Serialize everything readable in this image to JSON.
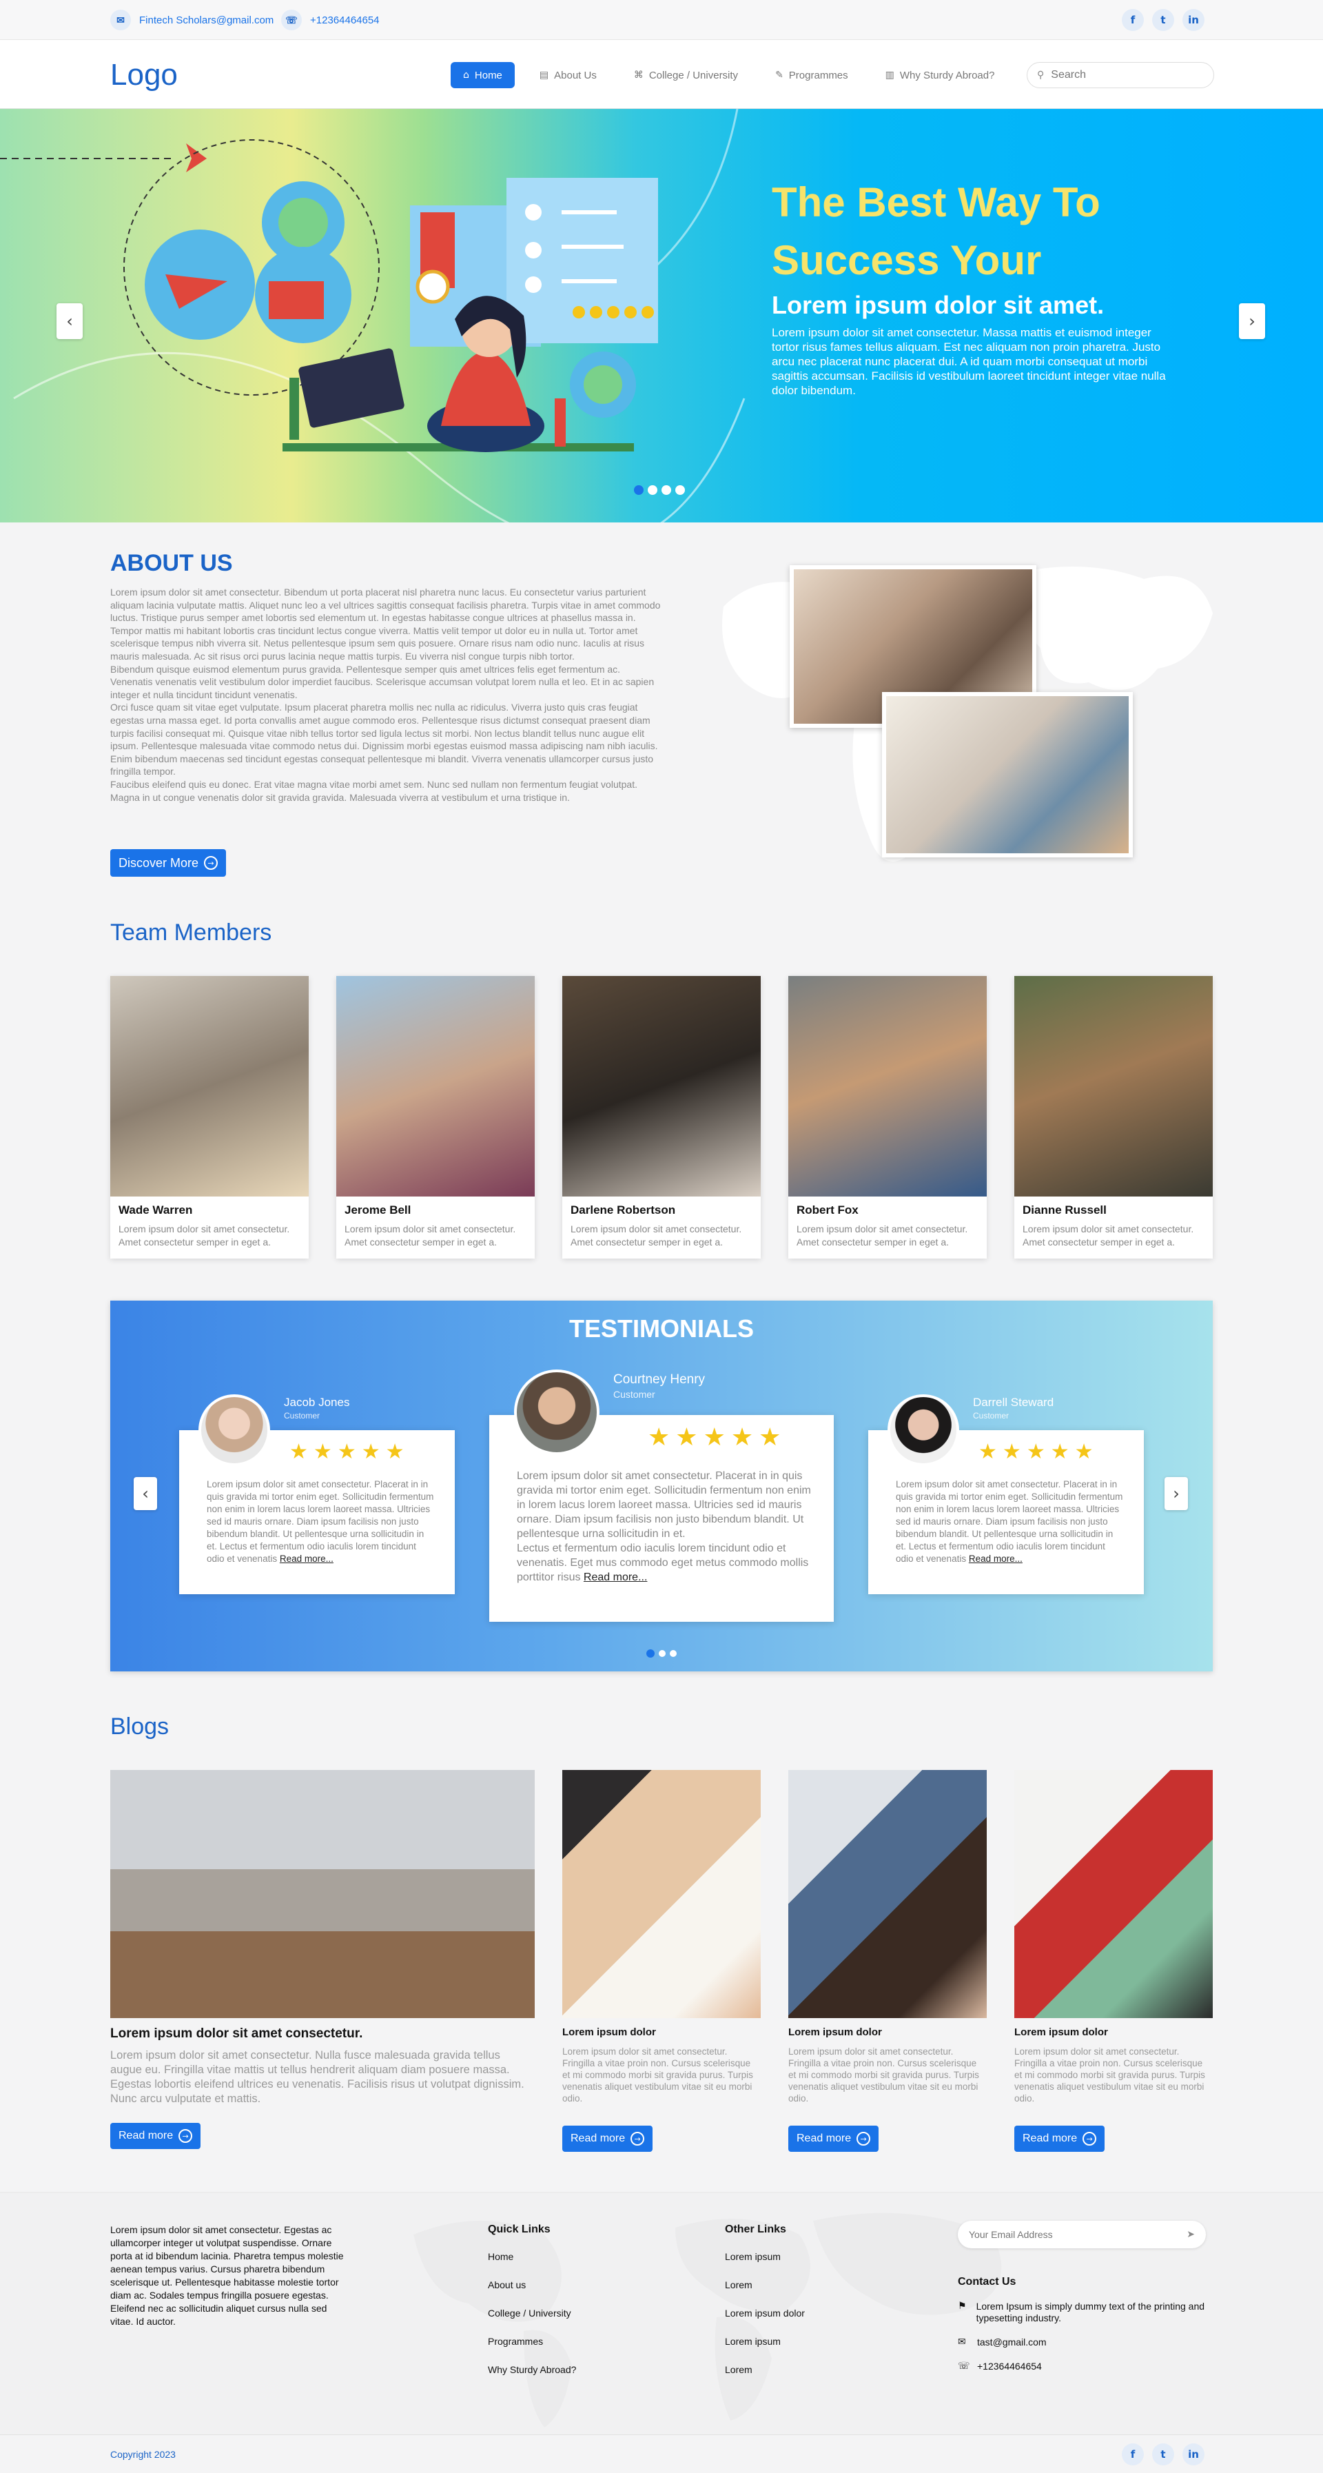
{
  "topbar": {
    "email": "Fintech Scholars@gmail.com",
    "phone": "+12364464654",
    "email_icon": "mail-icon",
    "phone_icon": "phone-icon",
    "social": [
      "facebook-icon",
      "twitter-icon",
      "linkedin-icon"
    ]
  },
  "header": {
    "logo": "Logo",
    "nav": [
      {
        "label": "Home",
        "icon": "home-icon",
        "active": true
      },
      {
        "label": "About Us",
        "icon": "document-icon"
      },
      {
        "label": "College / University",
        "icon": "building-icon"
      },
      {
        "label": "Programmes",
        "icon": "pen-icon"
      },
      {
        "label": "Why Sturdy Abroad?",
        "icon": "page-icon"
      }
    ],
    "search_placeholder": "Search"
  },
  "hero": {
    "title": "The Best Way To Success Your",
    "subtitle": "Lorem ipsum dolor sit amet.",
    "text": "Lorem ipsum dolor sit amet consectetur. Massa mattis et euismod integer tortor risus fames tellus aliquam. Est nec aliquam non proin pharetra. Justo arcu nec placerat nunc placerat dui. A id quam morbi consequat ut morbi sagittis accumsan. Facilisis id vestibulum laoreet tincidunt integer vitae nulla dolor bibendum.",
    "slides": 4,
    "active_slide": 1
  },
  "about": {
    "title": "ABOUT US",
    "text": "Lorem ipsum dolor sit amet consectetur. Bibendum ut porta placerat nisl pharetra nunc lacus. Eu consectetur varius parturient aliquam lacinia vulputate mattis. Aliquet nunc leo a vel ultrices sagittis consequat facilisis pharetra. Turpis vitae in amet commodo luctus. Tristique purus semper amet lobortis sed elementum ut. In egestas habitasse congue ultrices at phasellus massa in. Tempor mattis mi habitant lobortis cras tincidunt lectus congue viverra. Mattis velit tempor ut dolor eu in nulla ut. Tortor amet scelerisque tempus nibh viverra sit. Netus pellentesque ipsum sem quis posuere. Ornare risus nam odio nunc. Iaculis at risus mauris malesuada. Ac sit risus orci purus lacinia neque mattis turpis. Eu viverra nisl congue turpis nibh tortor.\nBibendum quisque euismod elementum purus gravida. Pellentesque semper quis amet ultrices felis eget fermentum ac. Venenatis venenatis velit vestibulum dolor imperdiet faucibus. Scelerisque accumsan volutpat lorem nulla et leo. Et in ac sapien integer et nulla tincidunt tincidunt venenatis.\nOrci fusce quam sit vitae eget vulputate. Ipsum placerat pharetra mollis nec nulla ac ridiculus. Viverra justo quis cras feugiat egestas urna massa eget. Id porta convallis amet augue commodo eros. Pellentesque risus dictumst consequat praesent diam turpis facilisi consequat mi. Quisque vitae nibh tellus tortor sed ligula lectus sit morbi. Non lectus blandit tellus nunc augue elit ipsum. Pellentesque malesuada vitae commodo netus dui. Dignissim morbi egestas euismod massa adipiscing nam nibh iaculis. Enim bibendum maecenas sed tincidunt egestas consequat pellentesque mi blandit. Viverra venenatis ullamcorper cursus justo fringilla tempor.\nFaucibus eleifend quis eu donec. Erat vitae magna vitae morbi amet sem. Nunc sed nullam non fermentum feugiat volutpat. Magna in ut congue venenatis dolor sit gravida gravida. Malesuada viverra at vestibulum et urna tristique in.",
    "button": "Discover More"
  },
  "team": {
    "title": "Team Members",
    "members": [
      {
        "name": "Wade Warren",
        "desc": "Lorem ipsum dolor sit amet consectetur. Amet consectetur semper in eget a."
      },
      {
        "name": "Jerome Bell",
        "desc": "Lorem ipsum dolor sit amet consectetur. Amet consectetur semper in eget a."
      },
      {
        "name": "Darlene Robertson",
        "desc": "Lorem ipsum dolor sit amet consectetur. Amet consectetur semper in eget a."
      },
      {
        "name": "Robert Fox",
        "desc": "Lorem ipsum dolor sit amet consectetur. Amet consectetur semper in eget a."
      },
      {
        "name": "Dianne Russell",
        "desc": "Lorem ipsum dolor sit amet consectetur. Amet consectetur semper in eget a."
      }
    ]
  },
  "testimonials": {
    "title": "TESTIMONIALS",
    "items": [
      {
        "name": "Jacob Jones",
        "role": "Customer",
        "rating": 5,
        "text": "Lorem ipsum dolor sit amet consectetur. Placerat in in quis gravida mi tortor enim eget. Sollicitudin fermentum non enim in lorem lacus lorem laoreet massa. Ultricies sed id mauris ornare. Diam ipsum facilisis non justo bibendum blandit. Ut pellentesque urna sollicitudin in et. Lectus et fermentum odio iaculis lorem tincidunt odio et venenatis",
        "more": "Read more..."
      },
      {
        "name": "Courtney Henry",
        "role": "Customer",
        "rating": 5,
        "text": "Lorem ipsum dolor sit amet consectetur. Placerat in in quis gravida mi tortor enim eget. Sollicitudin fermentum non enim in lorem lacus lorem laoreet massa. Ultricies sed id mauris ornare. Diam ipsum facilisis non justo bibendum blandit. Ut pellentesque urna sollicitudin in et.\nLectus et fermentum odio iaculis lorem tincidunt odio et venenatis. Eget mus commodo eget metus commodo mollis porttitor risus",
        "more": "Read more..."
      },
      {
        "name": "Darrell Steward",
        "role": "Customer",
        "rating": 5,
        "text": "Lorem ipsum dolor sit amet consectetur. Placerat in in quis gravida mi tortor enim eget. Sollicitudin fermentum non enim in lorem lacus lorem laoreet massa. Ultricies sed id mauris ornare. Diam ipsum facilisis non justo bibendum blandit. Ut pellentesque urna sollicitudin in et. Lectus et fermentum odio iaculis lorem tincidunt odio et venenatis",
        "more": "Read more..."
      }
    ],
    "slides": 3,
    "active_slide": 1
  },
  "blogs": {
    "title": "Blogs",
    "items": [
      {
        "title": "Lorem ipsum dolor sit amet consectetur.",
        "desc": "Lorem ipsum dolor sit amet consectetur. Nulla fusce malesuada gravida tellus augue eu. Fringilla vitae mattis ut tellus hendrerit aliquam diam posuere massa. Egestas lobortis eleifend ultrices eu venenatis. Facilisis risus ut volutpat dignissim. Nunc arcu vulputate et mattis.",
        "button": "Read more"
      },
      {
        "title": "Lorem ipsum dolor",
        "desc": "Lorem ipsum dolor sit amet consectetur. Fringilla a vitae proin non. Cursus scelerisque et mi commodo morbi sit gravida purus. Turpis venenatis aliquet vestibulum vitae sit eu morbi odio.",
        "button": "Read more"
      },
      {
        "title": "Lorem ipsum dolor",
        "desc": "Lorem ipsum dolor sit amet consectetur. Fringilla a vitae proin non. Cursus scelerisque et mi commodo morbi sit gravida purus. Turpis venenatis aliquet vestibulum vitae sit eu morbi odio.",
        "button": "Read more"
      },
      {
        "title": "Lorem ipsum dolor",
        "desc": "Lorem ipsum dolor sit amet consectetur. Fringilla a vitae proin non. Cursus scelerisque et mi commodo morbi sit gravida purus. Turpis venenatis aliquet vestibulum vitae sit eu morbi odio.",
        "button": "Read more"
      }
    ]
  },
  "footer": {
    "about": "Lorem ipsum dolor sit amet consectetur. Egestas ac ullamcorper integer ut volutpat suspendisse. Ornare porta at id bibendum lacinia. Pharetra tempus molestie aenean tempus varius. Cursus pharetra bibendum scelerisque ut. Pellentesque habitasse molestie tortor diam ac. Sodales tempus fringilla posuere egestas. Eleifend nec ac sollicitudin aliquet cursus nulla sed vitae. Id auctor.",
    "quick_links_title": "Quick Links",
    "quick_links": [
      "Home",
      "About us",
      "College / University",
      "Programmes",
      "Why Sturdy Abroad?"
    ],
    "other_links_title": "Other Links",
    "other_links": [
      "Lorem ipsum",
      "Lorem",
      "Lorem ipsum dolor",
      "Lorem ipsum",
      "Lorem"
    ],
    "email_placeholder": "Your Email Address",
    "contact_title": "Contact Us",
    "address": "Lorem Ipsum is simply dummy text of the printing and typesetting industry.",
    "email": "tast@gmail.com",
    "phone": "+12364464654",
    "copyright": "Copyright 2023"
  },
  "colors": {
    "accent": "#1a73e8",
    "hero_title": "#f7e36a",
    "star": "#f5c518"
  }
}
